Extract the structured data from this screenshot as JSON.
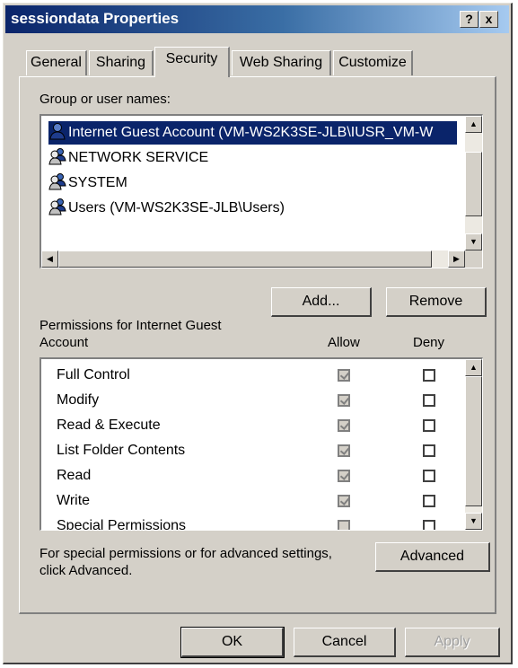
{
  "window": {
    "title": "sessiondata Properties",
    "help_glyph": "?",
    "close_glyph": "x"
  },
  "tabs": [
    {
      "label": "General"
    },
    {
      "label": "Sharing"
    },
    {
      "label": "Security",
      "active": true
    },
    {
      "label": "Web Sharing"
    },
    {
      "label": "Customize"
    }
  ],
  "security": {
    "group_label": "Group or user names:",
    "users": [
      {
        "name": "Internet Guest Account (VM-WS2K3SE-JLB\\IUSR_VM-W",
        "selected": true,
        "icon": "single-user-icon"
      },
      {
        "name": "NETWORK SERVICE",
        "icon": "group-user-icon"
      },
      {
        "name": "SYSTEM",
        "icon": "group-user-icon"
      },
      {
        "name": "Users (VM-WS2K3SE-JLB\\Users)",
        "icon": "group-user-icon"
      }
    ],
    "add_label": "Add...",
    "remove_label": "Remove",
    "permissions_label_line1": "Permissions for Internet Guest",
    "permissions_label_line2": "Account",
    "allow_header": "Allow",
    "deny_header": "Deny",
    "permissions": [
      {
        "name": "Full Control",
        "allow": true,
        "deny": false
      },
      {
        "name": "Modify",
        "allow": true,
        "deny": false
      },
      {
        "name": "Read & Execute",
        "allow": true,
        "deny": false
      },
      {
        "name": "List Folder Contents",
        "allow": true,
        "deny": false
      },
      {
        "name": "Read",
        "allow": true,
        "deny": false
      },
      {
        "name": "Write",
        "allow": true,
        "deny": false
      },
      {
        "name": "Special Permissions",
        "allow": false,
        "deny": false
      }
    ],
    "advanced_text_line1": "For special permissions or for advanced settings,",
    "advanced_text_line2": "click Advanced.",
    "advanced_label": "Advanced"
  },
  "buttons": {
    "ok": "OK",
    "cancel": "Cancel",
    "apply": "Apply"
  },
  "colors": {
    "title_start": "#0a246a",
    "title_end": "#a6caf0",
    "face": "#d4d0c8",
    "selection": "#0a246a"
  }
}
